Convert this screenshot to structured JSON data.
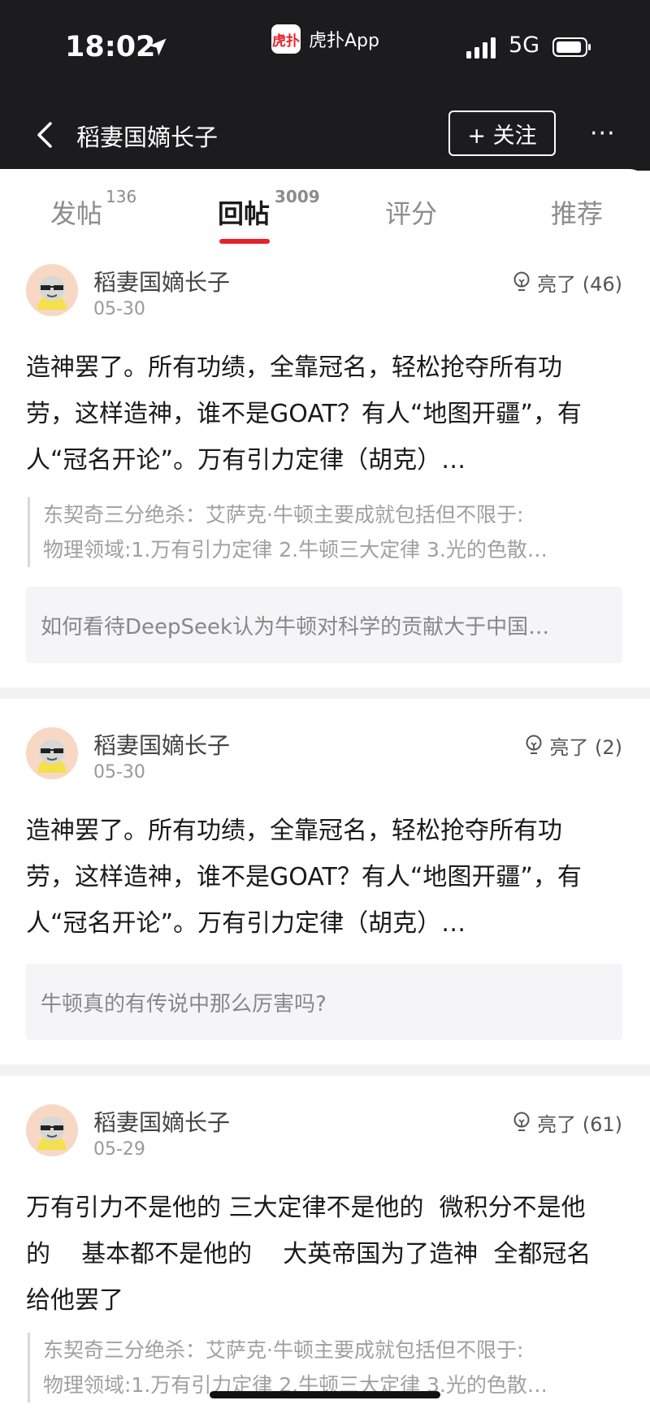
{
  "status_bar": {
    "time": "18:02",
    "app_logo_text": "虎扑",
    "app_name": "虎扑App",
    "network": "5G"
  },
  "nav": {
    "title": "稻妻国嫡长子",
    "follow_label": "+ 关注",
    "more_label": "···"
  },
  "tabs": [
    {
      "label": "发帖",
      "count": "136"
    },
    {
      "label": "回帖",
      "count": "3009"
    },
    {
      "label": "评分"
    },
    {
      "label": "推荐"
    }
  ],
  "posts": [
    {
      "username": "稻妻国嫡长子",
      "date": "05-30",
      "likes": "亮了 (46)",
      "text": "造神罢了。所有功绩，全靠冠名，轻松抢夺所有功劳，这样造神，谁不是GOAT？有人“地图开疆”，有人“冠名开论”。万有引力定律（胡克）…",
      "quote_line1": "东契奇三分绝杀：艾萨克·牛顿主要成就包括但不限于:",
      "quote_line2": "物理领域:1.万有引力定律 2.牛顿三大定律 3.光的色散…",
      "topic": "如何看待DeepSeek认为牛顿对科学的贡献大于中国…"
    },
    {
      "username": "稻妻国嫡长子",
      "date": "05-30",
      "likes": "亮了 (2)",
      "text": "造神罢了。所有功绩，全靠冠名，轻松抢夺所有功劳，这样造神，谁不是GOAT？有人“地图开疆”，有人“冠名开论”。万有引力定律（胡克）…",
      "topic": "牛顿真的有传说中那么厉害吗?"
    },
    {
      "username": "稻妻国嫡长子",
      "date": "05-29",
      "likes": "亮了 (61)",
      "text": "万有引力不是他的 三大定律不是他的  微积分不是他的    基本都不是他的    大英帝国为了造神  全都冠名给他罢了",
      "quote_line1": "东契奇三分绝杀：艾萨克·牛顿主要成就包括但不限于:",
      "quote_line2": "物理领域:1.万有引力定律 2.牛顿三大定律 3.光的色散…"
    }
  ],
  "colors": {
    "accent": "#e3242b",
    "topbar": "#1c1c1e",
    "divider": "#f2f2f4"
  }
}
